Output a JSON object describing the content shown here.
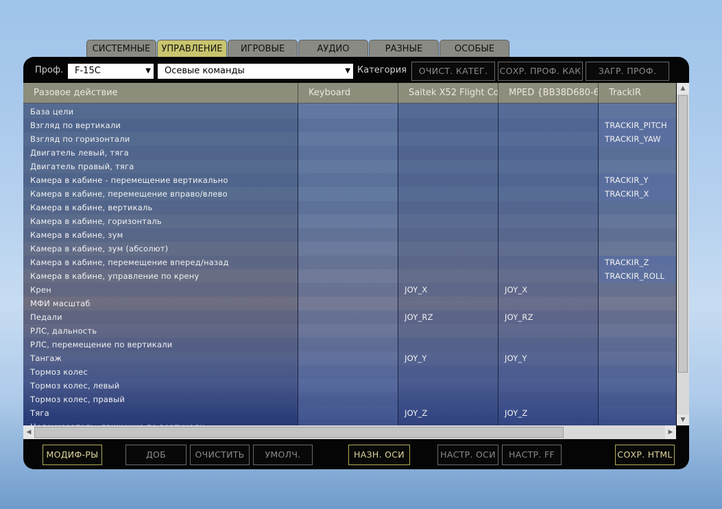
{
  "tabs": [
    "СИСТЕМНЫЕ",
    "УПРАВЛЕНИЕ",
    "ИГРОВЫЕ",
    "АУДИО",
    "РАЗНЫЕ",
    "ОСОБЫЕ"
  ],
  "active_tab": "УПРАВЛЕНИЕ",
  "toolbar": {
    "profile_label": "Проф.",
    "profile_value": "F-15C",
    "category_select_value": "Осевые команды",
    "category_label": "Категория",
    "clear_category": "ОЧИСТ. КАТЕГ.",
    "save_profile_as": "СОХР. ПРОФ. КАК",
    "load_profile": "ЗАГР. ПРОФ."
  },
  "columns": [
    "Разовое действие",
    "Keyboard",
    "Saitek X52 Flight Co",
    "MPED {BB38D680-6",
    "TrackIR"
  ],
  "rows": [
    [
      "База цели",
      "",
      "",
      "",
      ""
    ],
    [
      "Взгляд по вертикали",
      "",
      "",
      "",
      "TRACKIR_PITCH"
    ],
    [
      "Взгляд по горизонтали",
      "",
      "",
      "",
      "TRACKIR_YAW"
    ],
    [
      "Двигатель левый, тяга",
      "",
      "",
      "",
      ""
    ],
    [
      "Двигатель правый, тяга",
      "",
      "",
      "",
      ""
    ],
    [
      "Камера в кабине - перемещение вертикально",
      "",
      "",
      "",
      "TRACKIR_Y"
    ],
    [
      "Камера в кабине,  перемещение вправо/влево",
      "",
      "",
      "",
      "TRACKIR_X"
    ],
    [
      "Камера в кабине, вертикаль",
      "",
      "",
      "",
      ""
    ],
    [
      "Камера в кабине, горизонталь",
      "",
      "",
      "",
      ""
    ],
    [
      "Камера в кабине, зум",
      "",
      "",
      "",
      ""
    ],
    [
      "Камера в кабине, зум (абсолют)",
      "",
      "",
      "",
      ""
    ],
    [
      "Камера в кабине, перемещение вперед/назад",
      "",
      "",
      "",
      "TRACKIR_Z"
    ],
    [
      "Камера в кабине, управление по крену",
      "",
      "",
      "",
      "TRACKIR_ROLL"
    ],
    [
      "Крен",
      "",
      "JOY_X",
      "JOY_X",
      ""
    ],
    [
      "МФИ масштаб",
      "",
      "",
      "",
      ""
    ],
    [
      "Педали",
      "",
      "JOY_RZ",
      "JOY_RZ",
      ""
    ],
    [
      "РЛС, дальность",
      "",
      "",
      "",
      ""
    ],
    [
      "РЛС, перемещение по вертикали",
      "",
      "",
      "",
      ""
    ],
    [
      "Тангаж",
      "",
      "JOY_Y",
      "JOY_Y",
      ""
    ],
    [
      "Тормоз колес",
      "",
      "",
      "",
      ""
    ],
    [
      "Тормоз колес, левый",
      "",
      "",
      "",
      ""
    ],
    [
      "Тормоз колес, правый",
      "",
      "",
      "",
      ""
    ],
    [
      "Тяга",
      "",
      "JOY_Z",
      "JOY_Z",
      ""
    ],
    [
      "Целеуказатель, движение по вертикали",
      "",
      "",
      "",
      ""
    ]
  ],
  "bottom_buttons": {
    "modifiers": "МОДИФ-РЫ",
    "add": "ДОБ",
    "clear": "ОЧИСТИТЬ",
    "default": "УМОЛЧ.",
    "assign_axis": "НАЗН. ОСИ",
    "axis_tune": "НАСТР. ОСИ",
    "ff_tune": "НАСТР. FF",
    "save_html": "СОХР. HTML"
  }
}
